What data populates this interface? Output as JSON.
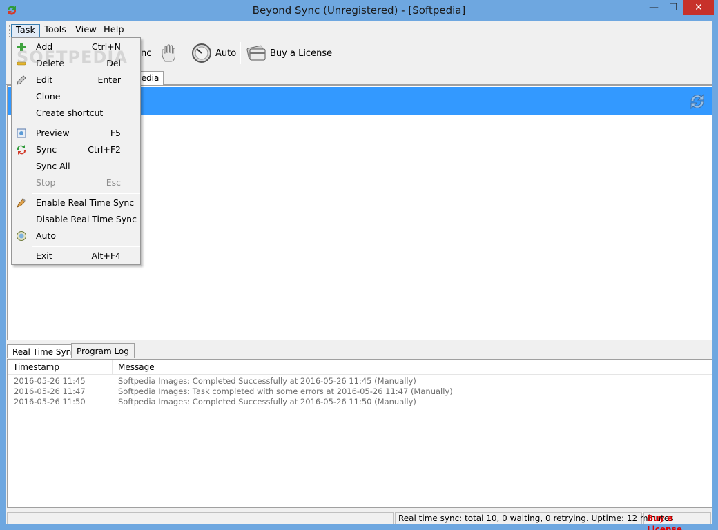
{
  "window": {
    "title": "Beyond Sync (Unregistered) - [Softpedia]",
    "min_glyph": "—",
    "max_glyph": "☐",
    "close_glyph": "✕"
  },
  "menubar": {
    "items": [
      "Task",
      "Tools",
      "View",
      "Help"
    ]
  },
  "toolbar": {
    "partial_sync_label": "nc",
    "auto_label": "Auto",
    "buy_label": "Buy a License"
  },
  "task_tabs": {
    "visible_tab": "pedia"
  },
  "task_menu": {
    "items": [
      {
        "label": "Add",
        "shortcut": "Ctrl+N",
        "icon": "plus-icon"
      },
      {
        "label": "Delete",
        "shortcut": "Del",
        "icon": "minus-icon"
      },
      {
        "label": "Edit",
        "shortcut": "Enter",
        "icon": "pencil-icon"
      },
      {
        "label": "Clone",
        "shortcut": ""
      },
      {
        "label": "Create shortcut",
        "shortcut": ""
      },
      {
        "label": "Preview",
        "shortcut": "F5",
        "icon": "preview-icon"
      },
      {
        "label": "Sync",
        "shortcut": "Ctrl+F2",
        "icon": "sync-icon"
      },
      {
        "label": "Sync All",
        "shortcut": ""
      },
      {
        "label": "Stop",
        "shortcut": "Esc",
        "disabled": true
      },
      {
        "label": "Enable Real Time Sync",
        "shortcut": "",
        "icon": "realtime-icon"
      },
      {
        "label": "Disable Real Time Sync",
        "shortcut": ""
      },
      {
        "label": "Auto",
        "shortcut": "",
        "icon": "auto-icon"
      },
      {
        "label": "Exit",
        "shortcut": "Alt+F4"
      }
    ]
  },
  "bottom_tabs": {
    "tabs": [
      "Real Time Sync",
      "Program Log"
    ],
    "active": "Program Log"
  },
  "log": {
    "columns": [
      "Timestamp",
      "Message"
    ],
    "rows": [
      {
        "timestamp": "2016-05-26 11:45",
        "message": "Softpedia Images: Completed Successfully at 2016-05-26 11:45 (Manually)"
      },
      {
        "timestamp": "2016-05-26 11:47",
        "message": "Softpedia Images: Task completed with some errors at 2016-05-26 11:47 (Manually)"
      },
      {
        "timestamp": "2016-05-26 11:50",
        "message": "Softpedia Images: Completed Successfully at 2016-05-26 11:50 (Manually)"
      }
    ]
  },
  "statusbar": {
    "realtime_text": "Real time sync: total 10, 0 waiting, 0 retrying. Uptime:  12 minutes",
    "buy_link": "Buy a License"
  },
  "watermark": "SOFTPEDIA",
  "colors": {
    "accent": "#3399ff",
    "frame": "#6ea7e0",
    "link": "#e00000"
  }
}
